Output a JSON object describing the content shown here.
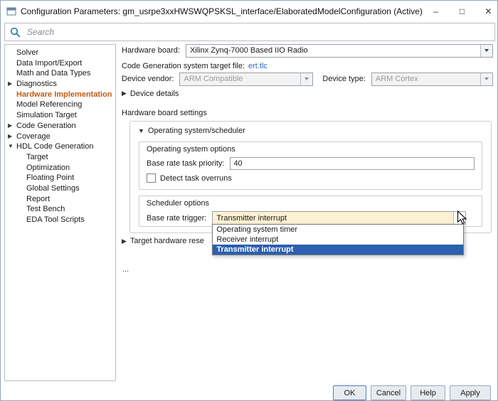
{
  "window": {
    "title": "Configuration Parameters: gm_usrpe3xxHWSWQPSKSL_interface/ElaboratedModelConfiguration (Active)",
    "minimize_glyph": "–",
    "maximize_glyph": "□",
    "close_glyph": "✕"
  },
  "search": {
    "placeholder": "Search"
  },
  "sidebar": {
    "items": [
      {
        "label": "Solver",
        "arrow": ""
      },
      {
        "label": "Data Import/Export",
        "arrow": ""
      },
      {
        "label": "Math and Data Types",
        "arrow": ""
      },
      {
        "label": "Diagnostics",
        "arrow": "▶"
      },
      {
        "label": "Hardware Implementation",
        "arrow": ""
      },
      {
        "label": "Model Referencing",
        "arrow": ""
      },
      {
        "label": "Simulation Target",
        "arrow": ""
      },
      {
        "label": "Code Generation",
        "arrow": "▶"
      },
      {
        "label": "Coverage",
        "arrow": "▶"
      },
      {
        "label": "HDL Code Generation",
        "arrow": "▼"
      },
      {
        "label": "Target",
        "arrow": ""
      },
      {
        "label": "Optimization",
        "arrow": ""
      },
      {
        "label": "Floating Point",
        "arrow": ""
      },
      {
        "label": "Global Settings",
        "arrow": ""
      },
      {
        "label": "Report",
        "arrow": ""
      },
      {
        "label": "Test Bench",
        "arrow": ""
      },
      {
        "label": "EDA Tool Scripts",
        "arrow": ""
      }
    ]
  },
  "main": {
    "hardware_board": {
      "label": "Hardware board:",
      "value": "Xilinx Zynq-7000 Based IIO Radio"
    },
    "target_file": {
      "label": "Code Generation system target file:",
      "link": "ert.tlc"
    },
    "device_vendor": {
      "label": "Device vendor:",
      "value": "ARM Compatible"
    },
    "device_type": {
      "label": "Device type:",
      "value": "ARM Cortex"
    },
    "device_details": {
      "arrow": "▶",
      "label": "Device details"
    },
    "board_settings_title": "Hardware board settings",
    "os_scheduler": {
      "arrow": "▼",
      "title": "Operating system/scheduler",
      "os_options": {
        "title": "Operating system options",
        "priority_label": "Base rate task priority:",
        "priority_value": "40",
        "overrun_label": "Detect task overruns"
      },
      "scheduler_options": {
        "title": "Scheduler options",
        "trigger_label": "Base rate trigger:",
        "trigger_value": "Transmitter interrupt",
        "options": [
          "Operating system timer",
          "Receiver interrupt",
          "Transmitter interrupt"
        ],
        "selected_option": "Transmitter interrupt"
      }
    },
    "target_hardware": {
      "arrow": "▶",
      "label": "Target hardware rese"
    },
    "ellipsis": "..."
  },
  "footer": {
    "buttons": [
      "OK",
      "Cancel",
      "Help",
      "Apply"
    ]
  },
  "colors": {
    "selected_sidebar_text": "#c05d15",
    "dropdown_selected_bg": "#2b5fb0",
    "focused_combo_bg": "#fcf1d2",
    "link": "#2a66c8"
  }
}
